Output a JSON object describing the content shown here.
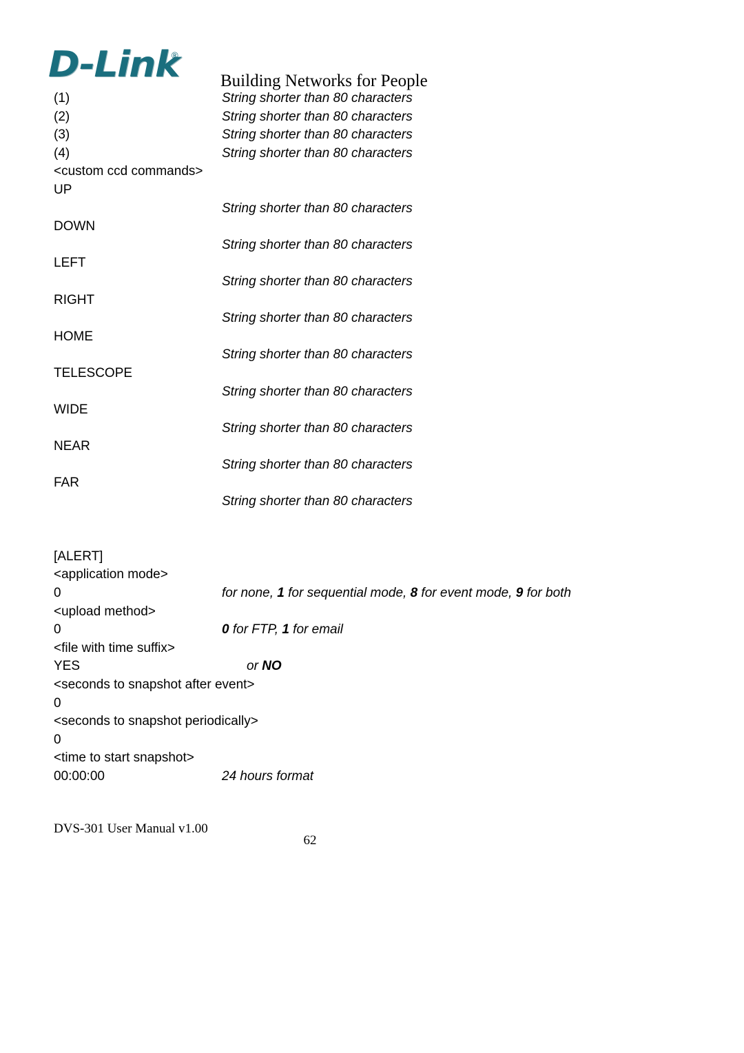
{
  "header": {
    "logo_text": "D-Link",
    "logo_registered_mark": "®",
    "tagline": "Building Networks for People",
    "logo_color": "#1a6e7e"
  },
  "numbered_rows": [
    {
      "label": "(1)",
      "description": "String shorter than 80 characters"
    },
    {
      "label": "(2)",
      "description": "String shorter than 80 characters"
    },
    {
      "label": "(3)",
      "description": "String shorter than 80 characters"
    },
    {
      "label": "(4)",
      "description": "String shorter than 80 characters"
    }
  ],
  "custom_ccd": {
    "section_header": "<custom ccd commands>",
    "commands": [
      {
        "label": "UP",
        "description": "String shorter than 80 characters"
      },
      {
        "label": "DOWN",
        "description": "String shorter than 80 characters"
      },
      {
        "label": "LEFT",
        "description": "String shorter than 80 characters"
      },
      {
        "label": "RIGHT",
        "description": "String shorter than 80 characters"
      },
      {
        "label": "HOME",
        "description": "String shorter than 80 characters"
      },
      {
        "label": "TELESCOPE",
        "description": "String shorter than 80 characters"
      },
      {
        "label": "WIDE",
        "description": "String shorter than 80 characters"
      },
      {
        "label": "NEAR",
        "description": "String shorter than 80 characters"
      },
      {
        "label": "FAR",
        "description": "String shorter than 80 characters"
      }
    ]
  },
  "alert": {
    "section_header": "[ALERT]",
    "entries": [
      {
        "param": "<application mode>",
        "value": "0",
        "description_html": "for none, <b>1</b> for sequential mode, <b>8</b> for event mode, <b>9</b> for both",
        "description_text": "for none, 1 for sequential mode, 8 for event mode, 9 for both",
        "indented": false
      },
      {
        "param": "<upload method>",
        "value": "0",
        "description_html": "<b>0</b> for FTP, <b>1</b> for email",
        "description_text": "0 for FTP, 1 for email",
        "indented": false
      },
      {
        "param": "<file with time suffix>",
        "value": "YES",
        "description_html": "or <b>NO</b>",
        "description_text": "or NO",
        "indented": true
      },
      {
        "param": "<seconds to snapshot after event>",
        "value": "0",
        "description_html": "",
        "description_text": "",
        "indented": false
      },
      {
        "param": "<seconds to snapshot periodically>",
        "value": "0",
        "description_html": "",
        "description_text": "",
        "indented": false
      },
      {
        "param": "<time to start snapshot>",
        "value": "00:00:00",
        "description_html": "24 hours format",
        "description_text": "24 hours format",
        "indented": false
      }
    ]
  },
  "footer": {
    "manual_title": "DVS-301 User Manual v1.00",
    "page_number": "62"
  }
}
